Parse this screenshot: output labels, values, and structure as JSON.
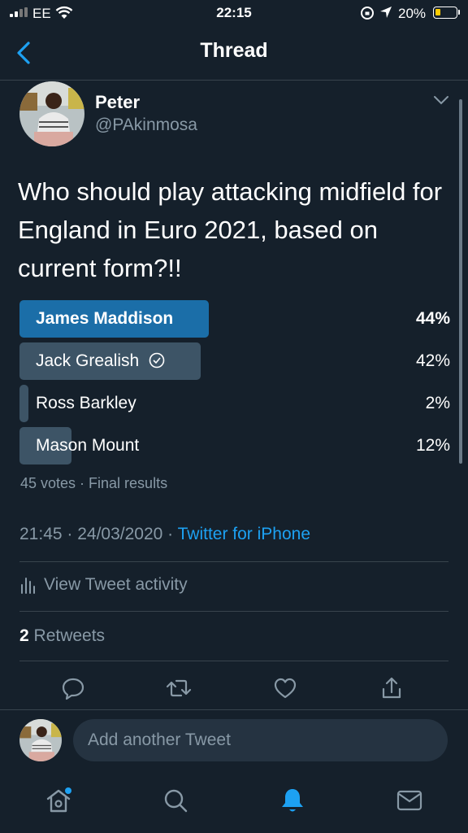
{
  "status_bar": {
    "carrier": "EE",
    "time": "22:15",
    "battery_percent": "20%",
    "battery_level": 0.2
  },
  "nav": {
    "title": "Thread"
  },
  "tweet": {
    "author_name": "Peter",
    "author_handle": "@PAkinmosa",
    "text": "Who should play attacking midfield for England in Euro 2021, based on current form?!!",
    "poll": {
      "options": [
        {
          "label": "James Maddison",
          "percent_label": "44%",
          "percent": 44,
          "winner": true
        },
        {
          "label": "Jack Grealish",
          "percent_label": "42%",
          "percent": 42,
          "winner": false,
          "selected_by_user": true
        },
        {
          "label": "Ross Barkley",
          "percent_label": "2%",
          "percent": 2,
          "winner": false
        },
        {
          "label": "Mason Mount",
          "percent_label": "12%",
          "percent": 12,
          "winner": false
        }
      ],
      "meta": "45 votes · Final results"
    },
    "timestamp": "21:45 · 24/03/2020 · ",
    "source": "Twitter for iPhone",
    "activity_label": "View Tweet activity",
    "retweet_count": "2",
    "retweet_label": " Retweets"
  },
  "reply": {
    "placeholder": "Add another Tweet"
  },
  "tabs": [
    "home-icon",
    "search-icon",
    "notifications-icon",
    "messages-icon"
  ],
  "colors": {
    "background": "#15202b",
    "accent": "#1da1f2",
    "winner_bar": "#1b6ea8",
    "other_bar": "#3d5466",
    "secondary_text": "#8899a6",
    "divider": "#38444d"
  }
}
